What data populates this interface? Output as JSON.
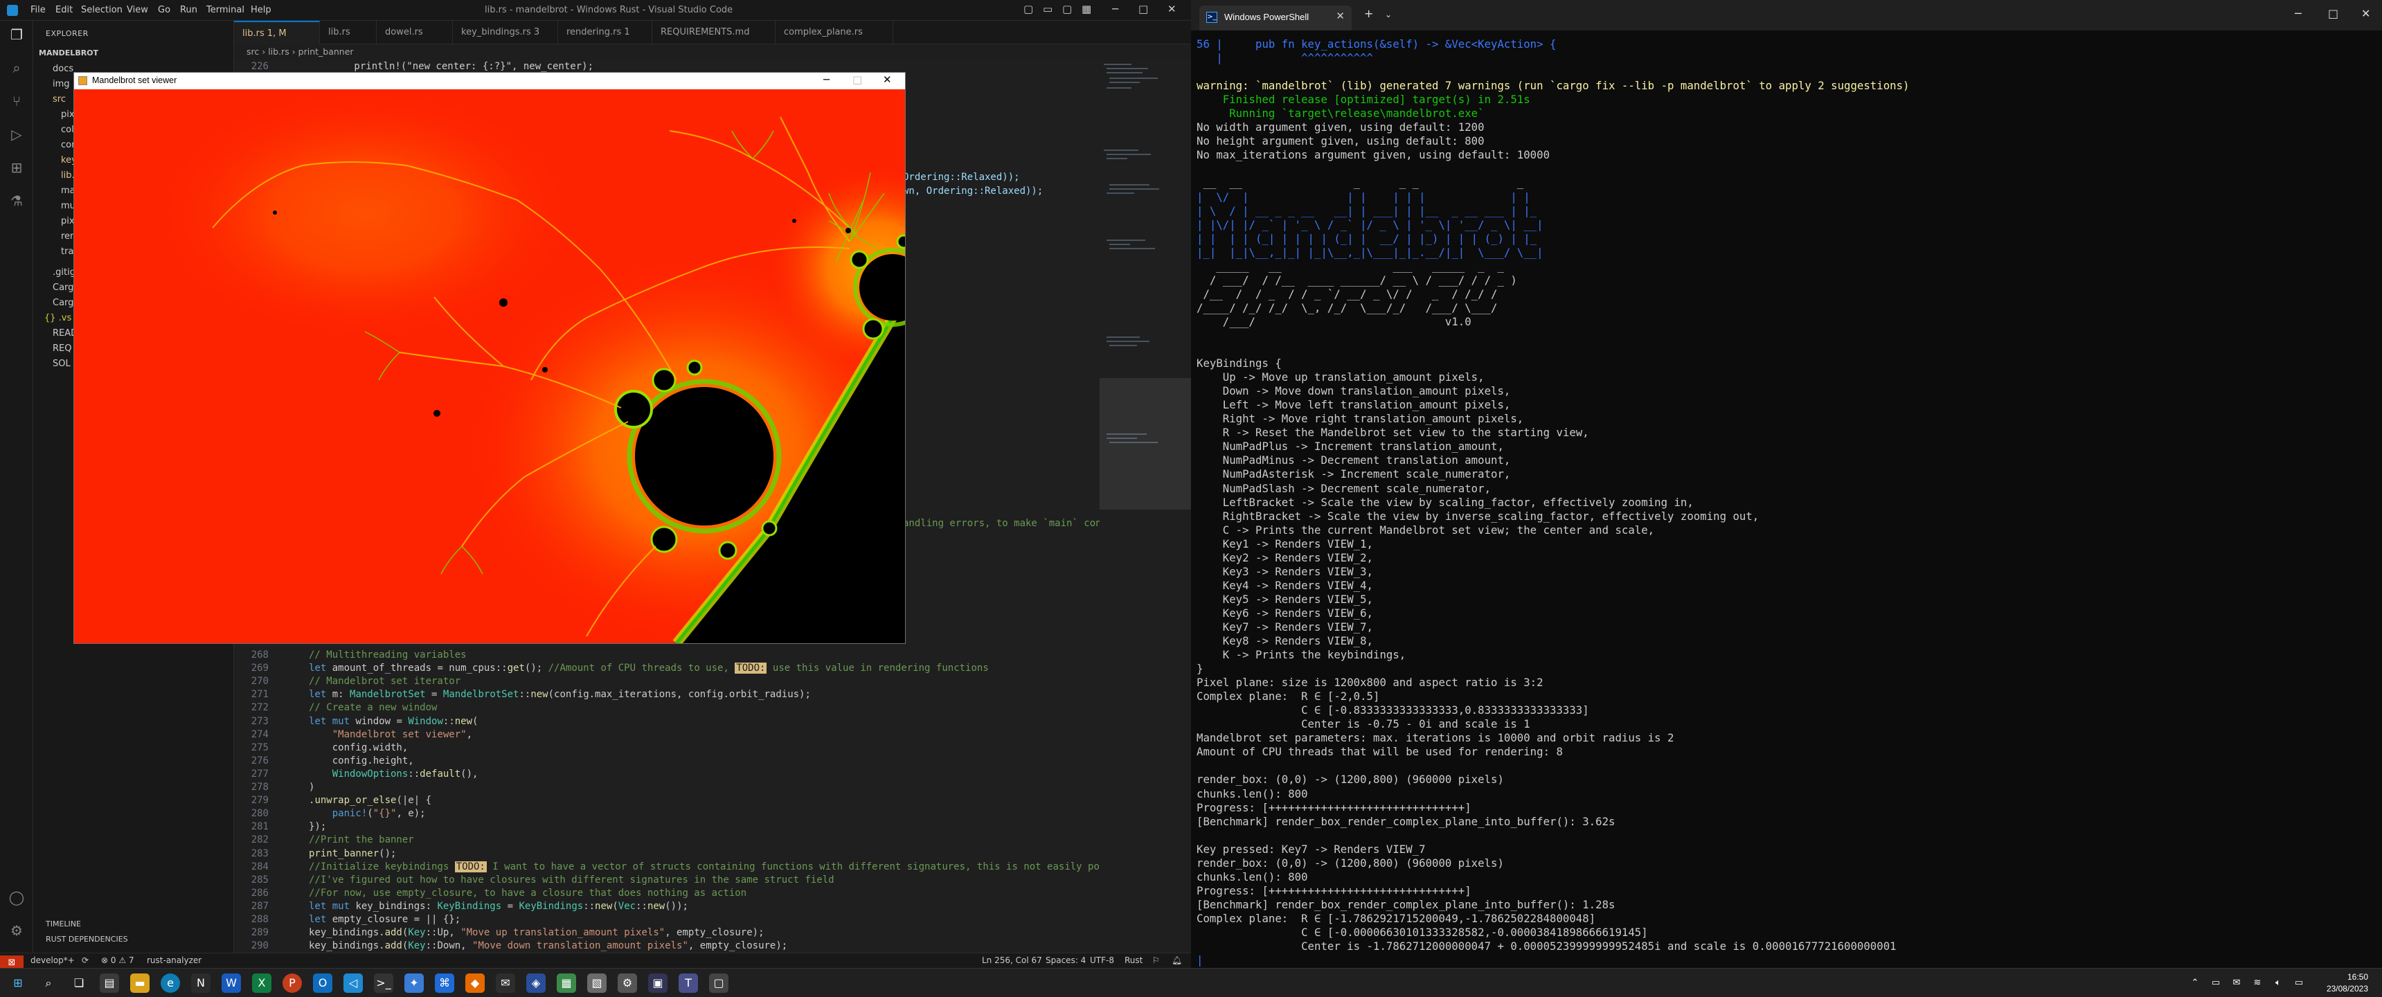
{
  "vscode": {
    "title": "lib.rs - mandelbrot - Windows Rust - Visual Studio Code",
    "menu": [
      "File",
      "Edit",
      "Selection",
      "View",
      "Go",
      "Run",
      "Terminal",
      "Help"
    ],
    "sidebar": {
      "header": "EXPLORER",
      "project": "MANDELBROT",
      "items": [
        "docs",
        "img",
        "src",
        "pixel",
        "col",
        "con",
        "key",
        "lib.rs",
        "ma",
        "mu",
        "pix",
        "ren",
        "tra",
        ".gitig",
        "Carg",
        "Carg",
        "{} .vs",
        "READ",
        "REQ",
        "SOL"
      ],
      "outline_timeline": "TIMELINE",
      "rust_deps": "RUST DEPENDENCIES"
    },
    "tabs": [
      {
        "label": "lib.rs  1, M",
        "active": true
      },
      {
        "label": "lib.rs",
        "active": false
      },
      {
        "label": "dowel.rs",
        "active": false
      },
      {
        "label": "key_bindings.rs  3",
        "active": false
      },
      {
        "label": "rendering.rs  1",
        "active": false
      },
      {
        "label": "REQUIREMENTS.md",
        "active": false
      },
      {
        "label": "complex_plane.rs",
        "active": false
      }
    ],
    "breadcrumb": "src › lib.rs › print_banner",
    "top_line": {
      "num": "226",
      "code": "        println!(\"new center: {:?}\", new_center);"
    },
    "right_fragments": [
      "Ordering::Relaxed));",
      "wn, Ordering::Relaxed));",
      "andling errors, to make `main` con"
    ],
    "lines": [
      {
        "n": "268",
        "html": "<span class='cm'>// Multithreading variables</span>"
      },
      {
        "n": "269",
        "html": "<span class='kw'>let</span> amount_of_threads = num_cpus::<span class='fn'>get</span>(); <span class='cm'>//Amount of CPU threads to use, <span class='todo'>TODO:</span> use this value in rendering functions</span>"
      },
      {
        "n": "270",
        "html": "<span class='cm'>// Mandelbrot set iterator</span>"
      },
      {
        "n": "271",
        "html": "<span class='kw'>let</span> m: <span class='ty'>MandelbrotSet</span> = <span class='ty'>MandelbrotSet</span>::<span class='fn'>new</span>(config.max_iterations, config.orbit_radius);"
      },
      {
        "n": "272",
        "html": "<span class='cm'>// Create a new window</span>"
      },
      {
        "n": "273",
        "html": "<span class='kw'>let mut</span> window = <span class='ty'>Window</span>::<span class='fn'>new</span>("
      },
      {
        "n": "274",
        "html": "    <span class='st'>\"Mandelbrot set viewer\"</span>,"
      },
      {
        "n": "275",
        "html": "    config.width,"
      },
      {
        "n": "276",
        "html": "    config.height,"
      },
      {
        "n": "277",
        "html": "    <span class='ty'>WindowOptions</span>::<span class='fn'>default</span>(),"
      },
      {
        "n": "278",
        "html": ")"
      },
      {
        "n": "279",
        "html": ".<span class='fn'>unwrap_or_else</span>(|e| {"
      },
      {
        "n": "280",
        "html": "    <span class='mac'>panic!</span>(<span class='st'>\"{}\"</span>, e);"
      },
      {
        "n": "281",
        "html": "});"
      },
      {
        "n": "282",
        "html": "<span class='cm'>//Print the banner</span>"
      },
      {
        "n": "283",
        "html": "<span class='fn'>print_banner</span>();"
      },
      {
        "n": "284",
        "html": "<span class='cm'>//Initialize keybindings <span class='todo'>TODO:</span> I want to have a vector of structs containing functions with different signatures, this is not easily possi</span>"
      },
      {
        "n": "285",
        "html": "<span class='cm'>//I've figured out how to have closures with different signatures in the same struct field</span>"
      },
      {
        "n": "286",
        "html": "<span class='cm'>//For now, use empty_closure, to have a closure that does nothing as action</span>"
      },
      {
        "n": "287",
        "html": "<span class='kw'>let mut</span> key_bindings: <span class='ty'>KeyBindings</span> = <span class='ty'>KeyBindings</span>::<span class='fn'>new</span>(<span class='ty'>Vec</span>::<span class='fn'>new</span>());"
      },
      {
        "n": "288",
        "html": "<span class='kw'>let</span> empty_closure = || {};"
      },
      {
        "n": "289",
        "html": "key_bindings.<span class='fn'>add</span>(<span class='ty'>Key</span>::Up, <span class='st'>\"Move up translation_amount pixels\"</span>, empty_closure);"
      },
      {
        "n": "290",
        "html": "key_bindings.<span class='fn'>add</span>(<span class='ty'>Key</span>::Down, <span class='st'>\"Move down translation_amount pixels\"</span>, empty_closure);"
      }
    ],
    "status": {
      "remote": "⊠",
      "branch": "develop*+",
      "sync": "⟳",
      "problems": "⊗ 0 ⚠ 7",
      "lsp": "rust-analyzer",
      "position": "Ln 256, Col 67",
      "spaces": "Spaces: 4",
      "encoding": "UTF-8",
      "language": "Rust"
    }
  },
  "mandelbrot_window": {
    "title": "Mandelbrot set viewer"
  },
  "powershell": {
    "tab_title": "Windows PowerShell",
    "lines": [
      "56 |     pub fn key_actions(&self) -> &Vec<KeyAction> {",
      "   |            ^^^^^^^^^^^",
      "",
      "warning: `mandelbrot` (lib) generated 7 warnings (run `cargo fix --lib -p mandelbrot` to apply 2 suggestions)",
      "    Finished release [optimized] target(s) in 2.51s",
      "     Running `target\\release\\mandelbrot.exe`",
      "No width argument given, using default: 1200",
      "No height argument given, using default: 800",
      "No max_iterations argument given, using default: 10000",
      "",
      " __  __                 _      _ _               _   ",
      "|  \\/  |               | |    | | |             | |  ",
      "| \\  / | __ _ _ __   __| | ___| | |__  _ __ ___ | |_ ",
      "| |\\/| |/ _` | '_ \\ / _` |/ _ \\ | '_ \\| '__/ _ \\| __|",
      "| |  | | (_| | | | | (_| |  __/ | |_) | | | (_) | |_ ",
      "|_|  |_|\\__,_|_| |_|\\__,_|\\___|_|_.__/|_|  \\___/ \\__|",
      "   _____   __                 ___   _____  _  _ ",
      "  / ___/  / /__  ____ ______/ __ \\ / ___/ / / _ )",
      " /__  /  / _  / / _ `/ __/ _ \\/ /   _  / /_/ /",
      "/____/ /_/ /_/  \\_, /_/  \\___/_/   /___/ \\___/",
      "    /___/                             v1.0",
      "",
      "",
      "KeyBindings {",
      "    Up -> Move up translation_amount pixels,",
      "    Down -> Move down translation_amount pixels,",
      "    Left -> Move left translation_amount pixels,",
      "    Right -> Move right translation_amount pixels,",
      "    R -> Reset the Mandelbrot set view to the starting view,",
      "    NumPadPlus -> Increment translation_amount,",
      "    NumPadMinus -> Decrement translation amount,",
      "    NumPadAsterisk -> Increment scale_numerator,",
      "    NumPadSlash -> Decrement scale_numerator,",
      "    LeftBracket -> Scale the view by scaling_factor, effectively zooming in,",
      "    RightBracket -> Scale the view by inverse_scaling_factor, effectively zooming out,",
      "    C -> Prints the current Mandelbrot set view; the center and scale,",
      "    Key1 -> Renders VIEW_1,",
      "    Key2 -> Renders VIEW_2,",
      "    Key3 -> Renders VIEW_3,",
      "    Key4 -> Renders VIEW_4,",
      "    Key5 -> Renders VIEW_5,",
      "    Key6 -> Renders VIEW_6,",
      "    Key7 -> Renders VIEW_7,",
      "    Key8 -> Renders VIEW_8,",
      "    K -> Prints the keybindings,",
      "}",
      "Pixel plane: size is 1200x800 and aspect ratio is 3:2",
      "Complex plane:  R ∈ [-2,0.5]",
      "                C ∈ [-0.8333333333333333,0.8333333333333333]",
      "                Center is -0.75 - 0i and scale is 1",
      "Mandelbrot set parameters: max. iterations is 10000 and orbit radius is 2",
      "Amount of CPU threads that will be used for rendering: 8",
      "",
      "render_box: (0,0) -> (1200,800) (960000 pixels)",
      "chunks.len(): 800",
      "Progress: [++++++++++++++++++++++++++++++]",
      "[Benchmark] render_box_render_complex_plane_into_buffer(): 3.62s",
      "",
      "Key pressed: Key7 -> Renders VIEW_7",
      "render_box: (0,0) -> (1200,800) (960000 pixels)",
      "chunks.len(): 800",
      "Progress: [++++++++++++++++++++++++++++++]",
      "[Benchmark] render_box_render_complex_plane_into_buffer(): 1.28s",
      "Complex plane:  R ∈ [-1.7862921715200049,-1.7862502284800048]",
      "                C ∈ [-0.00006630101333328582,-0.00003841898666619145]",
      "                Center is -1.7862712000000047 + 0.00005239999999952485i and scale is 0.00001677721600000001",
      "|"
    ]
  },
  "taskbar": {
    "time": "16:50",
    "date": "23/08/2023"
  }
}
